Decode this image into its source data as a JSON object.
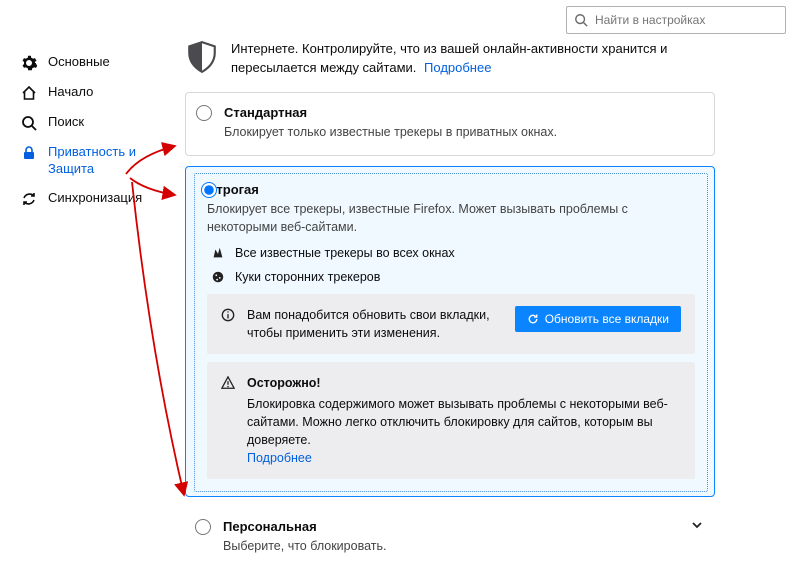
{
  "search": {
    "placeholder": "Найти в настройках"
  },
  "sidebar": {
    "items": [
      {
        "label": "Основные"
      },
      {
        "label": "Начало"
      },
      {
        "label": "Поиск"
      },
      {
        "label": "Приватность и Защита"
      },
      {
        "label": "Синхронизация"
      }
    ]
  },
  "intro": {
    "text": "Интернете. Контролируйте, что из вашей онлайн-активности хранится и пересылается между сайтами.",
    "more": "Подробнее"
  },
  "levels": {
    "standard": {
      "title": "Стандартная",
      "desc": "Блокирует только известные трекеры в приватных окнах."
    },
    "strict": {
      "title": "Строгая",
      "desc": "Блокирует все трекеры, известные Firefox. Может вызывать проблемы с некоторыми веб-сайтами.",
      "feat1": "Все известные трекеры во всех окнах",
      "feat2": "Куки сторонних трекеров",
      "reload_notice": "Вам понадобится обновить свои вкладки, чтобы применить эти изменения.",
      "reload_btn": "Обновить все вкладки",
      "warn_title": "Осторожно!",
      "warn_text": "Блокировка содержимого может вызывать проблемы с некоторыми веб-сайтами. Можно легко отключить блокировку для сайтов, которым вы доверяете.",
      "warn_more": "Подробнее"
    },
    "custom": {
      "title": "Персональная",
      "desc": "Выберите, что блокировать."
    }
  }
}
